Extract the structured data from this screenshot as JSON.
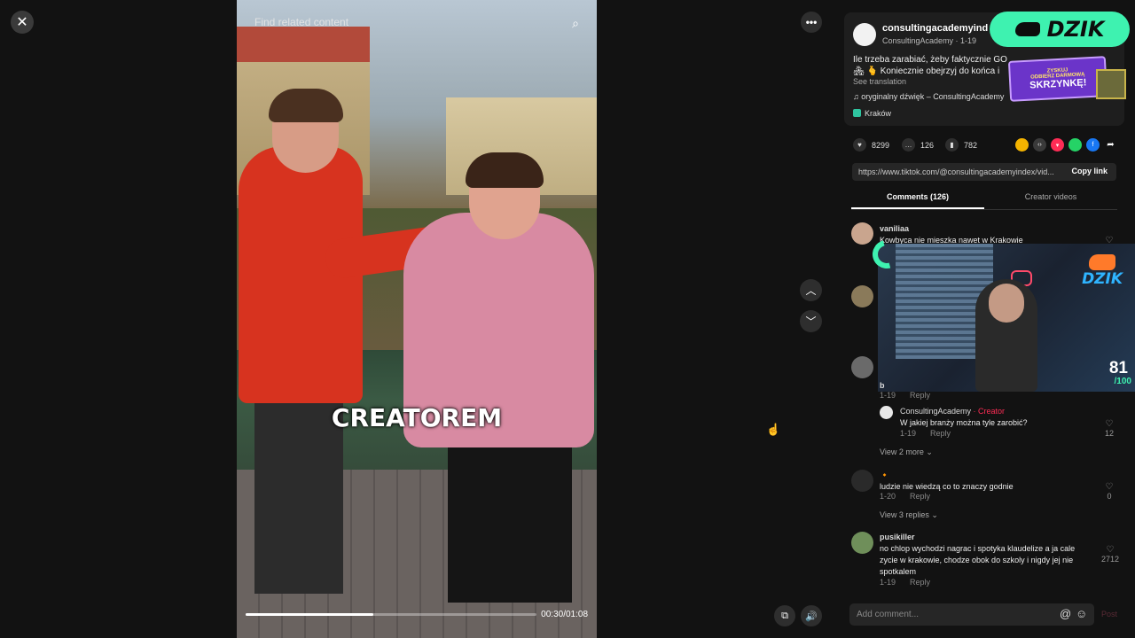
{
  "player": {
    "find_related": "Find related content",
    "caption": "CREATOREM",
    "time": "00:30/01:08",
    "progress_fraction": 0.44
  },
  "icons": {
    "close": "✕",
    "more": "•••",
    "up": "︿",
    "down": "﹀",
    "search": "⌕",
    "miniplayer": "⧉",
    "volume": "🔊",
    "cursor": "☝"
  },
  "creator": {
    "username": "consultingacademyind",
    "sub": "ConsultingAcademy · 1-19",
    "description_line1": "Ile trzeba zarabiać, żeby faktycznie GO",
    "description_line2": "🏘 🫰 Koniecznie obejrzyj do końca i",
    "see_translation": "See translation",
    "sound": "♫  oryginalny dźwięk – ConsultingAcademy",
    "location": "Kraków"
  },
  "overlay": {
    "dzik_badge": "DZIK",
    "promo_small": "ZYSKUJ",
    "promo_line1": "ODBIERZ DARMOWĄ",
    "promo_line2": "SKRZYNKĘ!",
    "stream_logo": "DZIK",
    "score": "81",
    "score_of": "/100"
  },
  "stats": {
    "likes": "8299",
    "comments": "126",
    "saves": "782"
  },
  "share_colors": [
    "#f5b400",
    "#3a3a3a",
    "#fe2c55",
    "#25d366",
    "#1877f2"
  ],
  "link": {
    "url": "https://www.tiktok.com/@consultingacademyindex/vid...",
    "copy_label": "Copy link"
  },
  "tabs": {
    "comments": "Comments (126)",
    "creator_videos": "Creator videos"
  },
  "comments": [
    {
      "user": "vaniliaa",
      "text": "Kowbyca nie mieszka nawet w Krakowie"
    },
    {
      "user": "b",
      "date": "1-19",
      "reply": "Reply"
    },
    {
      "user": "ConsultingAcademy",
      "tag": " · Creator",
      "text": "W jakiej branży można tyle zarobić?",
      "date": "1-19",
      "reply": "Reply",
      "likes": "12"
    },
    {
      "view_more": "View 2 more ⌄"
    },
    {
      "user": "🔸",
      "text": "ludzie nie wiedzą co to znaczy godnie",
      "date": "1-20",
      "reply": "Reply",
      "likes": "0",
      "view_more": "View 3 replies ⌄"
    },
    {
      "user": "pusikiller",
      "text": "no chlop wychodzi nagrac i spotyka klaudelize a ja cale zycie w krakowie, chodze obok do szkoly i nigdy jej nie spotkalem",
      "date": "1-19",
      "reply": "Reply",
      "likes": "2712"
    }
  ],
  "composer": {
    "placeholder": "Add comment...",
    "at": "@",
    "emoji": "☺",
    "post": "Post"
  }
}
